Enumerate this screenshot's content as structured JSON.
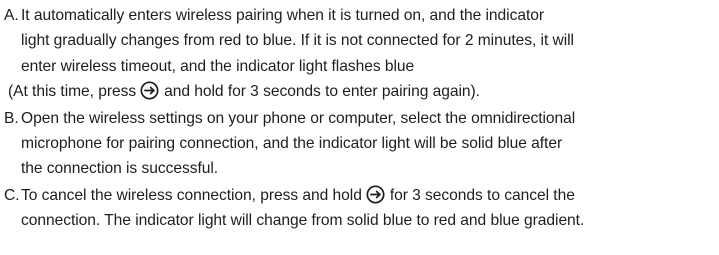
{
  "instructions": {
    "a": {
      "marker": "A.",
      "lines": [
        "It automatically enters wireless pairing when it is turned on, and the indicator",
        "light gradually changes from red to blue. If it is not connected for 2 minutes, it will",
        "enter wireless timeout, and the indicator light flashes blue"
      ],
      "line4_before": "(At this time, press",
      "line4_after": "and hold for 3 seconds to enter pairing again)."
    },
    "b": {
      "marker": "B.",
      "lines": [
        "Open the wireless settings on your phone or computer, select the omnidirectional",
        "microphone for pairing connection, and the indicator light will be solid blue after",
        "the connection is successful."
      ]
    },
    "c": {
      "marker": "C.",
      "line1_before": "To cancel the wireless connection, press and hold",
      "line1_after": "for 3 seconds to cancel the",
      "line2": "connection. The indicator light will change from solid blue to red and blue gradient."
    }
  },
  "icons": {
    "pairing_button": "circled-right-arrow-icon"
  },
  "colors": {
    "text": "#1e1e1e",
    "background": "#ffffff"
  }
}
